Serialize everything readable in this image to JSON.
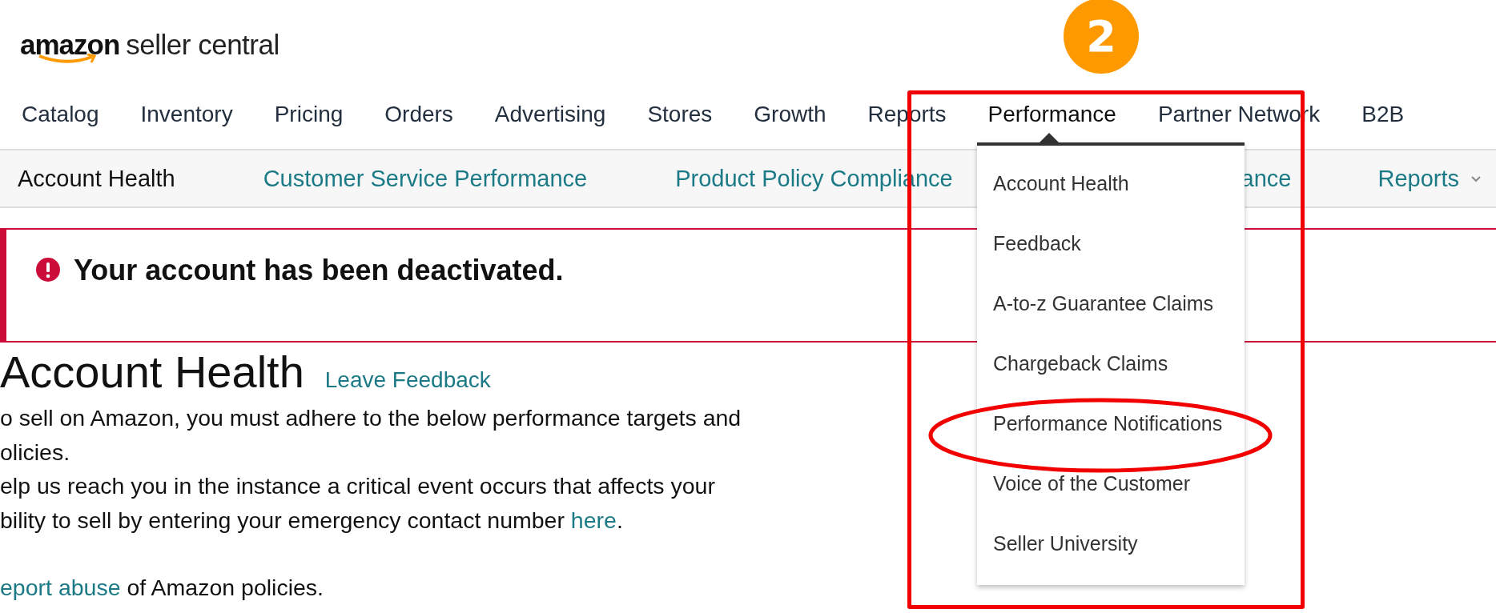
{
  "logo": {
    "brand": "amazon",
    "product": "seller central"
  },
  "nav": [
    {
      "label": "Catalog",
      "open": false
    },
    {
      "label": "Inventory",
      "open": false
    },
    {
      "label": "Pricing",
      "open": false
    },
    {
      "label": "Orders",
      "open": false
    },
    {
      "label": "Advertising",
      "open": false
    },
    {
      "label": "Stores",
      "open": false
    },
    {
      "label": "Growth",
      "open": false
    },
    {
      "label": "Reports",
      "open": false
    },
    {
      "label": "Performance",
      "open": true
    },
    {
      "label": "Partner Network",
      "open": false
    },
    {
      "label": "B2B",
      "open": false
    }
  ],
  "subnav": [
    {
      "label": "Account Health",
      "selected": true
    },
    {
      "label": "Customer Service Performance",
      "selected": false
    },
    {
      "label": "Product Policy Compliance",
      "selected": false
    },
    {
      "label": "ance",
      "selected": false
    },
    {
      "label": "Reports",
      "selected": false,
      "kind": "dropdown"
    }
  ],
  "alert": {
    "message": "Your account has been deactivated."
  },
  "page_title": "Account Health",
  "feedback_link": "Leave Feedback",
  "intro": {
    "lines": [
      "o sell on Amazon, you must adhere to the below performance targets and",
      "olicies."
    ]
  },
  "contact": {
    "lines": [
      "elp us reach you in the instance a critical event occurs that affects your",
      "bility to sell by entering your emergency contact number "
    ],
    "link": "here",
    "after": "."
  },
  "abuse": {
    "link": "eport abuse",
    "after": " of Amazon policies."
  },
  "menu": [
    {
      "label": "Account Health",
      "circled": false
    },
    {
      "label": "Feedback",
      "circled": false
    },
    {
      "label": "A-to-z Guarantee Claims",
      "circled": false
    },
    {
      "label": "Chargeback Claims",
      "circled": false
    },
    {
      "label": "Performance Notifications",
      "circled": true
    },
    {
      "label": "Voice of the Customer",
      "circled": false
    },
    {
      "label": "Seller University",
      "circled": false
    }
  ],
  "annotation": {
    "step": "2"
  }
}
